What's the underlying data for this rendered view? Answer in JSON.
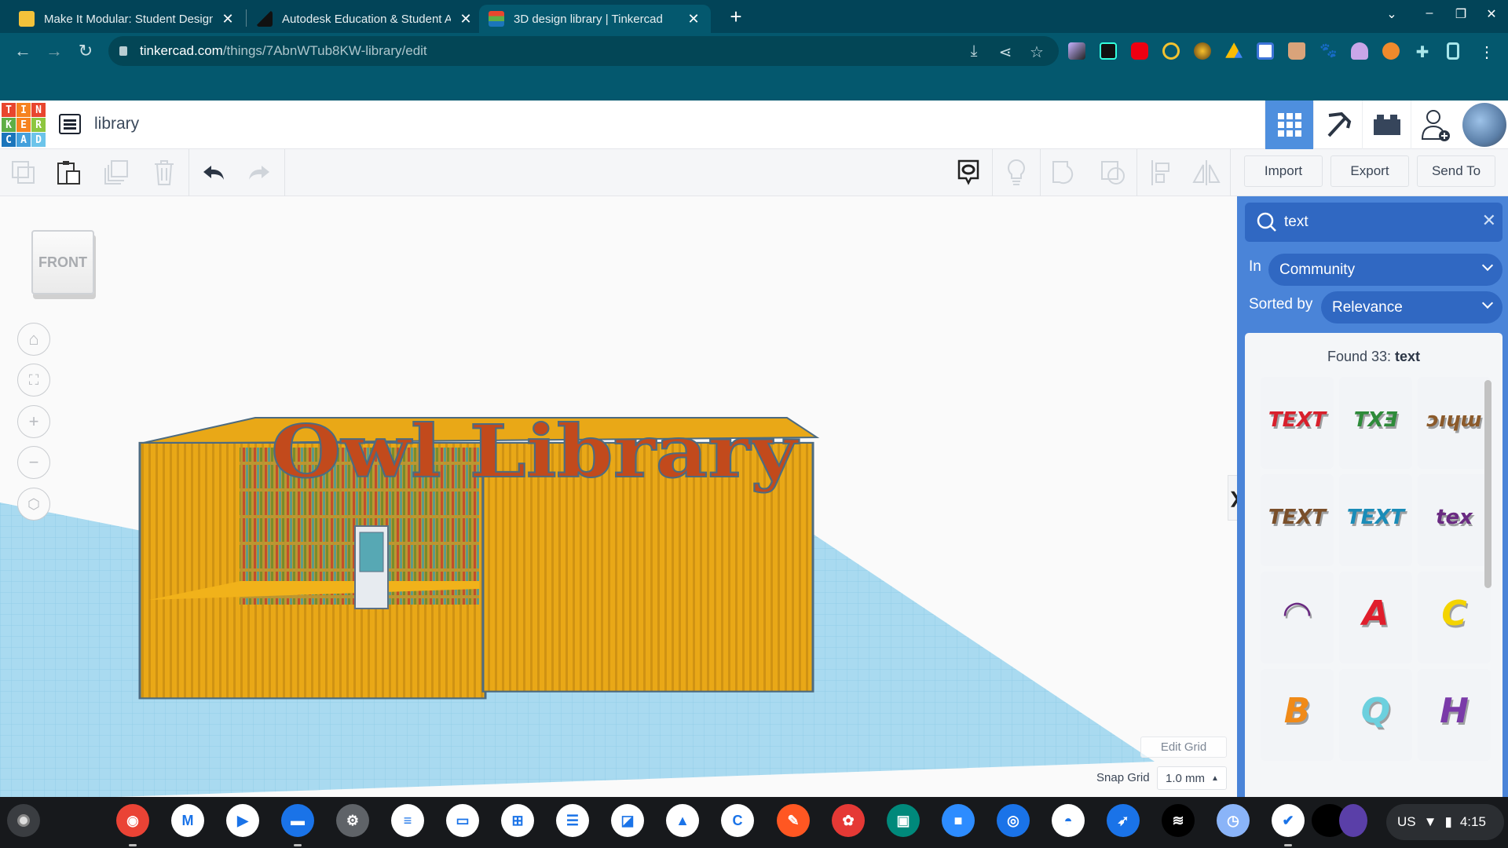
{
  "browser": {
    "tabs": [
      {
        "title": "Make It Modular: Student Design",
        "icon": "student-avatar-icon",
        "active": false
      },
      {
        "title": "Autodesk Education & Student Access",
        "icon": "autodesk-logo-icon",
        "active": false
      },
      {
        "title": "3D design library | Tinkercad",
        "icon": "tinkercad-logo-icon",
        "active": true
      }
    ],
    "new_tab": "+",
    "url_host": "tinkercad.com",
    "url_path": "/things/7AbnWTub8KW-library/edit",
    "extensions": [
      "cursor-extension-icon",
      "docs-extension-icon",
      "screencast-extension-icon",
      "coin-extension-icon",
      "bee-extension-icon",
      "drive-extension-icon",
      "screen-record-extension-icon",
      "coffee-extension-icon",
      "paw-extension-icon",
      "avatar-extension-icon",
      "fox-extension-icon",
      "puzzle-extensions-icon",
      "side-panel-icon",
      "menu-icon"
    ],
    "colors": {
      "frame": "#024458",
      "toolbar": "#04586e"
    }
  },
  "app": {
    "logo_letters": [
      "T",
      "I",
      "N",
      "K",
      "E",
      "R",
      "C",
      "A",
      "D"
    ],
    "logo_colors": [
      "#e8462e",
      "#f6821f",
      "#e8462e",
      "#5fae46",
      "#f6821f",
      "#8dc63f",
      "#1b75bb",
      "#44a0dc",
      "#6cc4ea"
    ],
    "design_name": "library",
    "header_buttons": [
      "3d-design-view",
      "blocks-view",
      "bricks-view",
      "invite-user"
    ]
  },
  "toolbar": {
    "import_label": "Import",
    "export_label": "Export",
    "send_to_label": "Send To"
  },
  "workplane": {
    "view_cube_label": "FRONT",
    "sign_text": "Owl Library",
    "edit_grid_label": "Edit Grid",
    "snap_grid_label": "Snap Grid",
    "snap_grid_value": "1.0 mm",
    "collapse_glyph": "❯"
  },
  "panel": {
    "search_value": "text",
    "in_label": "In",
    "in_value": "Community",
    "sorted_label": "Sorted by",
    "sorted_value": "Relevance",
    "found_prefix": "Found 33:",
    "found_query": "text",
    "results": [
      {
        "name": "red TEXT",
        "label": "TEXT",
        "color": "#d8202c"
      },
      {
        "name": "green TXE",
        "label": "TXƎ",
        "color": "#2e8b3a"
      },
      {
        "name": "brown text",
        "label": "ᴐıɥɯ",
        "color": "#8b5a2b"
      },
      {
        "name": "brown double TEXT",
        "label": "TEXT",
        "color": "#7a4f2a"
      },
      {
        "name": "blue TEXT",
        "label": "TEXT",
        "color": "#1a8cb8"
      },
      {
        "name": "purple tex",
        "label": "tex",
        "color": "#6a2a82"
      },
      {
        "name": "purple pipe",
        "label": "◠",
        "color": "#6a2a82"
      },
      {
        "name": "red A",
        "label": "A",
        "color": "#e01e2c"
      },
      {
        "name": "yellow C",
        "label": "C",
        "color": "#f4d400"
      },
      {
        "name": "orange B",
        "label": "B",
        "color": "#f08a18"
      },
      {
        "name": "cyan Q",
        "label": "Q",
        "color": "#6cd0de"
      },
      {
        "name": "purple H",
        "label": "H",
        "color": "#7a3aa8"
      }
    ]
  },
  "shelf": {
    "apps": [
      {
        "name": "chrome",
        "color": "#ea4335",
        "glyph": "◉"
      },
      {
        "name": "gmail",
        "color": "#ffffff",
        "glyph": "M"
      },
      {
        "name": "play-store",
        "color": "#ffffff",
        "glyph": "▶"
      },
      {
        "name": "files",
        "color": "#1a73e8",
        "glyph": "▬"
      },
      {
        "name": "settings",
        "color": "#5f6368",
        "glyph": "⚙"
      },
      {
        "name": "docs",
        "color": "#ffffff",
        "glyph": "≡"
      },
      {
        "name": "slides",
        "color": "#ffffff",
        "glyph": "▭"
      },
      {
        "name": "sheets",
        "color": "#ffffff",
        "glyph": "⊞"
      },
      {
        "name": "forms",
        "color": "#ffffff",
        "glyph": "☰"
      },
      {
        "name": "pdf",
        "color": "#ffffff",
        "glyph": "◪"
      },
      {
        "name": "drive",
        "color": "#ffffff",
        "glyph": "▲"
      },
      {
        "name": "c-app",
        "color": "#ffffff",
        "glyph": "C"
      },
      {
        "name": "pen-app",
        "color": "#ff5722",
        "glyph": "✎"
      },
      {
        "name": "paint-app",
        "color": "#e53935",
        "glyph": "✿"
      },
      {
        "name": "classroom",
        "color": "#00897b",
        "glyph": "▣"
      },
      {
        "name": "zoom",
        "color": "#2d8cff",
        "glyph": "■"
      },
      {
        "name": "camera",
        "color": "#1a73e8",
        "glyph": "◎"
      },
      {
        "name": "web-store",
        "color": "#ffffff",
        "glyph": "◓"
      },
      {
        "name": "rocket-app",
        "color": "#1a73e8",
        "glyph": "➶"
      },
      {
        "name": "spotify",
        "color": "#000000",
        "glyph": "≋"
      },
      {
        "name": "clock",
        "color": "#8ab4f8",
        "glyph": "◷"
      },
      {
        "name": "tasks",
        "color": "#ffffff",
        "glyph": "✔"
      }
    ],
    "tray_locale": "US",
    "tray_time": "4:15"
  }
}
